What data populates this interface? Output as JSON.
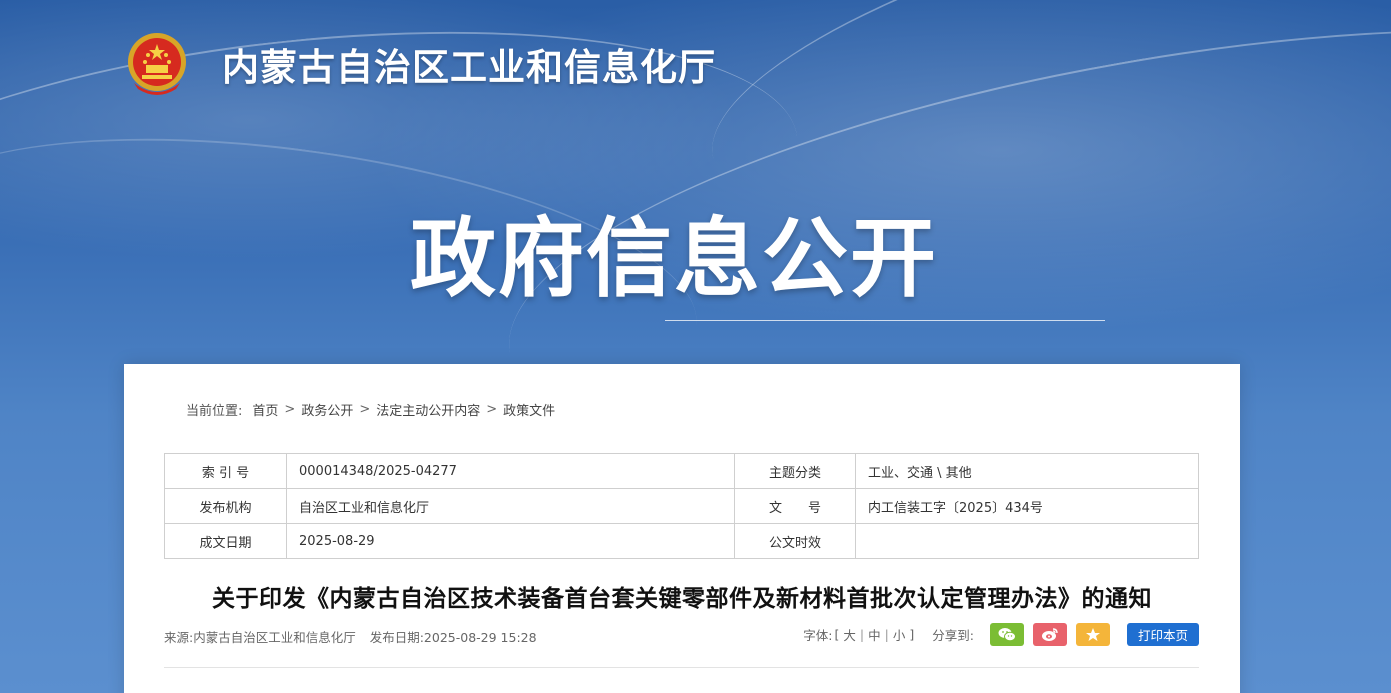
{
  "site": {
    "title": "内蒙古自治区工业和信息化厅"
  },
  "hero": {
    "title": "政府信息公开"
  },
  "breadcrumb": {
    "label": "当前位置:",
    "separator": ">",
    "items": [
      "首页",
      "政务公开",
      "法定主动公开内容",
      "政策文件"
    ]
  },
  "meta_table": {
    "rows": [
      {
        "k1": "索 引 号",
        "v1": "000014348/2025-04277",
        "k2": "主题分类",
        "v2": "工业、交通 \\ 其他"
      },
      {
        "k1": "发布机构",
        "v1": "自治区工业和信息化厅",
        "k2": "文　　号",
        "v2": "内工信装工字〔2025〕434号"
      },
      {
        "k1": "成文日期",
        "v1": "2025-08-29",
        "k2": "公文时效",
        "v2": ""
      }
    ]
  },
  "article": {
    "title": "关于印发《内蒙古自治区技术装备首台套关键零部件及新材料首批次认定管理办法》的通知",
    "source": "来源:内蒙古自治区工业和信息化厅",
    "publish": "发布日期:2025-08-29 15:28"
  },
  "tools": {
    "font_label": "字体:",
    "bracket_open": "[",
    "bracket_close": "]",
    "divider": "|",
    "font_large": "大",
    "font_medium": "中",
    "font_small": "小",
    "share_label": "分享到:",
    "print_label": "打印本页",
    "share_icons": [
      "wechat-icon",
      "weibo-icon",
      "favorite-star-icon"
    ],
    "colors": {
      "wechat": "#7bbd34",
      "weibo": "#e8626b",
      "favorite": "#f4b53a",
      "print": "#1f6fd1"
    }
  }
}
